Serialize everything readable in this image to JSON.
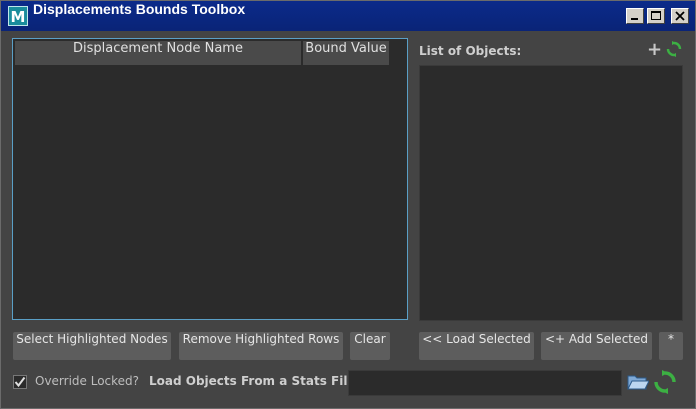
{
  "window": {
    "title": "Displacements Bounds Toolbox",
    "app_icon_letter": "M",
    "controls": [
      "minimize-icon",
      "maximize-icon",
      "close-icon"
    ]
  },
  "table": {
    "columns": [
      "Displacement Node Name",
      "Bound Value"
    ],
    "rows": []
  },
  "objects": {
    "label": "List of Objects:",
    "add_icon": "plus-icon",
    "refresh_icon": "refresh-icon",
    "items": []
  },
  "buttons": {
    "select_highlighted": "Select Highlighted Nodes",
    "remove_highlighted": "Remove Highlighted Rows",
    "clear": "Clear",
    "load_selected": "<< Load Selected",
    "add_selected": "<+ Add Selected",
    "star": "*"
  },
  "footer": {
    "override_label": "Override Locked?",
    "override_checked": true,
    "stats_label": "Load Objects From a Stats File:",
    "stats_value": "",
    "folder_icon": "folder-open-icon",
    "refresh_icon": "refresh-icon"
  },
  "colors": {
    "titlebar": "#0a2477",
    "panel_bg": "#2b2b2b",
    "window_bg": "#444444",
    "focus_border": "#5a9fc6",
    "refresh_green": "#3cb043"
  }
}
